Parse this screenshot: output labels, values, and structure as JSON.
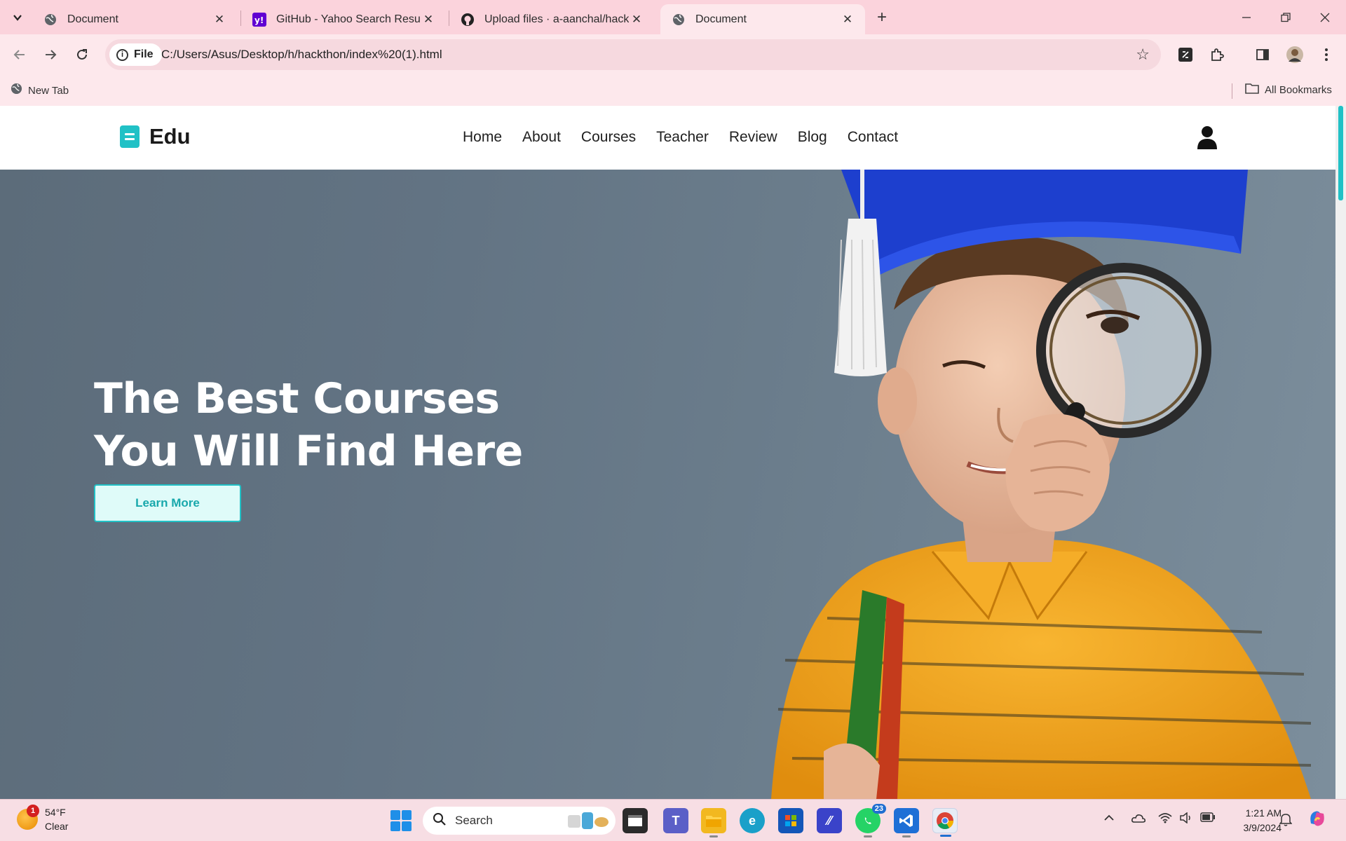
{
  "browser": {
    "tabs": [
      {
        "title": "Document",
        "active": false
      },
      {
        "title": "GitHub - Yahoo Search Results",
        "active": false
      },
      {
        "title": "Upload files · a-aanchal/hackath",
        "active": false
      },
      {
        "title": "Document",
        "active": true
      }
    ],
    "address": {
      "scheme_label": "File",
      "url": "C:/Users/Asus/Desktop/h/hackthon/index%20(1).html"
    },
    "bookmarks": {
      "left_item": "New Tab",
      "right_item": "All Bookmarks"
    }
  },
  "site": {
    "brand": "Edu",
    "nav": [
      "Home",
      "About",
      "Courses",
      "Teacher",
      "Review",
      "Blog",
      "Contact"
    ],
    "hero": {
      "title_line1": "The Best Courses",
      "title_line2": "You Will Find Here",
      "cta": "Learn More"
    },
    "accent_color": "#21c1c6"
  },
  "taskbar": {
    "weather": {
      "temp": "54°F",
      "condition": "Clear",
      "alerts": "1"
    },
    "search_placeholder": "Search",
    "whatsapp_badge": "23",
    "clock": {
      "time": "1:21 AM",
      "date": "3/9/2024"
    }
  }
}
